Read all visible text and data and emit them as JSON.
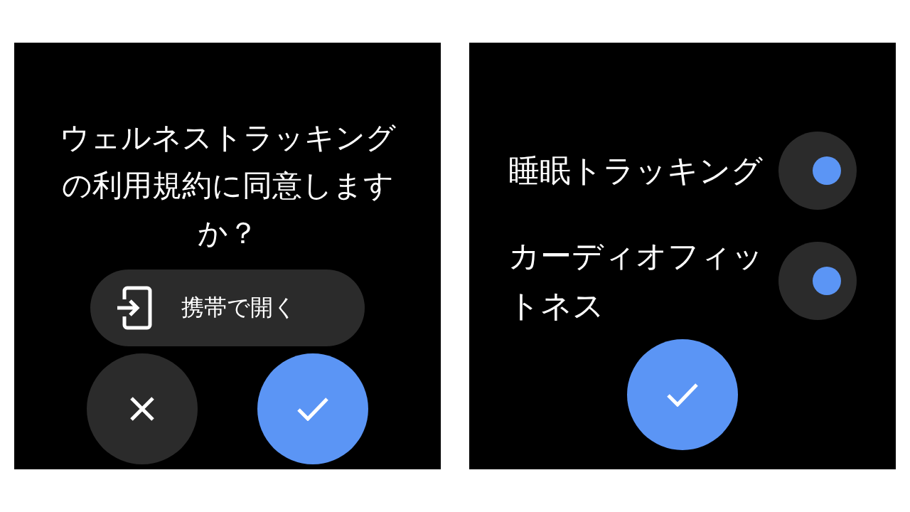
{
  "screens": [
    {
      "kind": "consent",
      "title": "ウェルネストラッキングの利用規約に同意しますか？",
      "open_on_phone": {
        "label": "携帯で開く"
      },
      "actions": [
        {
          "kind": "cancel"
        },
        {
          "kind": "confirm"
        }
      ]
    },
    {
      "kind": "settings",
      "toggles": [
        {
          "label": "睡眠トラッキング",
          "on": true
        },
        {
          "label": "カーディオフィットネス",
          "on": true
        }
      ],
      "actions": [
        {
          "kind": "confirm"
        }
      ]
    }
  ]
}
